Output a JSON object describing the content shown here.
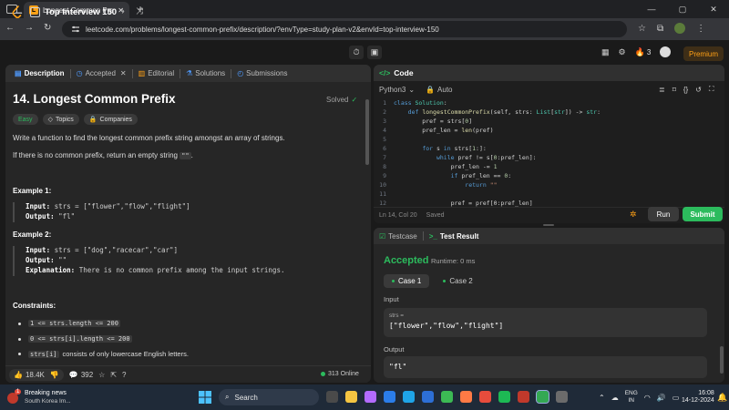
{
  "browser": {
    "tab_title": "Longest Common Prefix - LeetC",
    "url": "leetcode.com/problems/longest-common-prefix/description/?envType=study-plan-v2&envId=top-interview-150",
    "window_controls": [
      "—",
      "▢",
      "✕"
    ]
  },
  "header": {
    "list_title": "Top Interview 150",
    "streak_count": "3",
    "premium_label": "Premium"
  },
  "left_panel": {
    "tabs": [
      {
        "label": "Description",
        "icon": "doc-icon"
      },
      {
        "label": "Accepted",
        "icon": "history-icon"
      },
      {
        "label": "Editorial",
        "icon": "book-icon"
      },
      {
        "label": "Solutions",
        "icon": "flask-icon"
      },
      {
        "label": "Submissions",
        "icon": "clock-icon"
      }
    ],
    "title": "14. Longest Common Prefix",
    "solved_label": "Solved",
    "tags": {
      "difficulty": "Easy",
      "topics": "Topics",
      "companies": "Companies"
    },
    "description_1": "Write a function to find the longest common prefix string amongst an array of strings.",
    "description_2_pre": "If there is no common prefix, return an empty string ",
    "description_2_code": "\"\"",
    "description_2_post": ".",
    "example1": {
      "title": "Example 1:",
      "input_label": "Input:",
      "input": "strs = [\"flower\",\"flow\",\"flight\"]",
      "output_label": "Output:",
      "output": "\"fl\""
    },
    "example2": {
      "title": "Example 2:",
      "input_label": "Input:",
      "input": "strs = [\"dog\",\"racecar\",\"car\"]",
      "output_label": "Output:",
      "output": "\"\"",
      "explanation_label": "Explanation:",
      "explanation": "There is no common prefix among the input strings."
    },
    "constraints_title": "Constraints:",
    "constraints": [
      {
        "code": "1 <= strs.length <= 200",
        "text": ""
      },
      {
        "code": "0 <= strs[i].length <= 200",
        "text": ""
      },
      {
        "code": "strs[i]",
        "text": "consists of only lowercase English letters."
      }
    ],
    "likes": "18.4K",
    "comments": "392",
    "online": "313 Online"
  },
  "code_panel": {
    "title": "Code",
    "language": "Python3",
    "autocomplete": "Auto",
    "lines": [
      [
        [
          "kw",
          "class "
        ],
        [
          "ty",
          "Solution"
        ],
        [
          "tx",
          ":"
        ]
      ],
      [
        [
          "tx",
          "    "
        ],
        [
          "kw",
          "def "
        ],
        [
          "fn",
          "longestCommonPrefix"
        ],
        [
          "tx",
          "(self, strs: "
        ],
        [
          "ty",
          "List"
        ],
        [
          "tx",
          "["
        ],
        [
          "ty",
          "str"
        ],
        [
          "tx",
          "]) -> "
        ],
        [
          "ty",
          "str"
        ],
        [
          "tx",
          ":"
        ]
      ],
      [
        [
          "tx",
          "        pref = strs["
        ],
        [
          "nm",
          "0"
        ],
        [
          "tx",
          "]"
        ]
      ],
      [
        [
          "tx",
          "        pref_len = "
        ],
        [
          "fn",
          "len"
        ],
        [
          "tx",
          "(pref)"
        ]
      ],
      [
        [
          "tx",
          ""
        ]
      ],
      [
        [
          "tx",
          "        "
        ],
        [
          "kw",
          "for "
        ],
        [
          "tx",
          "s "
        ],
        [
          "kw",
          "in "
        ],
        [
          "tx",
          "strs["
        ],
        [
          "nm",
          "1"
        ],
        [
          "tx",
          ":]:"
        ]
      ],
      [
        [
          "tx",
          "            "
        ],
        [
          "kw",
          "while "
        ],
        [
          "tx",
          "pref != s["
        ],
        [
          "nm",
          "0"
        ],
        [
          "tx",
          ":pref_len]:"
        ]
      ],
      [
        [
          "tx",
          "                pref_len -= "
        ],
        [
          "nm",
          "1"
        ]
      ],
      [
        [
          "tx",
          "                "
        ],
        [
          "kw",
          "if "
        ],
        [
          "tx",
          "pref_len == "
        ],
        [
          "nm",
          "0"
        ],
        [
          "tx",
          ":"
        ]
      ],
      [
        [
          "tx",
          "                    "
        ],
        [
          "kw",
          "return "
        ],
        [
          "st",
          "\"\""
        ]
      ],
      [
        [
          "tx",
          ""
        ]
      ],
      [
        [
          "tx",
          "                pref = pref[0:pref_len]"
        ]
      ]
    ],
    "status_position": "Ln 14, Col 20",
    "status_saved": "Saved",
    "run_label": "Run",
    "submit_label": "Submit"
  },
  "test_panel": {
    "tab_testcase": "Testcase",
    "tab_result": "Test Result",
    "result": "Accepted",
    "runtime": "Runtime: 0 ms",
    "cases": [
      "Case 1",
      "Case 2"
    ],
    "input_label": "Input",
    "input_var": "strs =",
    "input_value": "[\"flower\",\"flow\",\"flight\"]",
    "output_label": "Output",
    "output_value": "\"fl\""
  },
  "taskbar": {
    "news_title": "Breaking news",
    "news_sub": "South Korea Im...",
    "news_badge": "1",
    "search_placeholder": "Search",
    "lang_1": "ENG",
    "lang_2": "IN",
    "time": "16:08",
    "date": "14-12-2024"
  },
  "colors": {
    "accent_green": "#2cbb5d",
    "leetcode_orange": "#ffa116",
    "panel_bg": "#262626"
  }
}
